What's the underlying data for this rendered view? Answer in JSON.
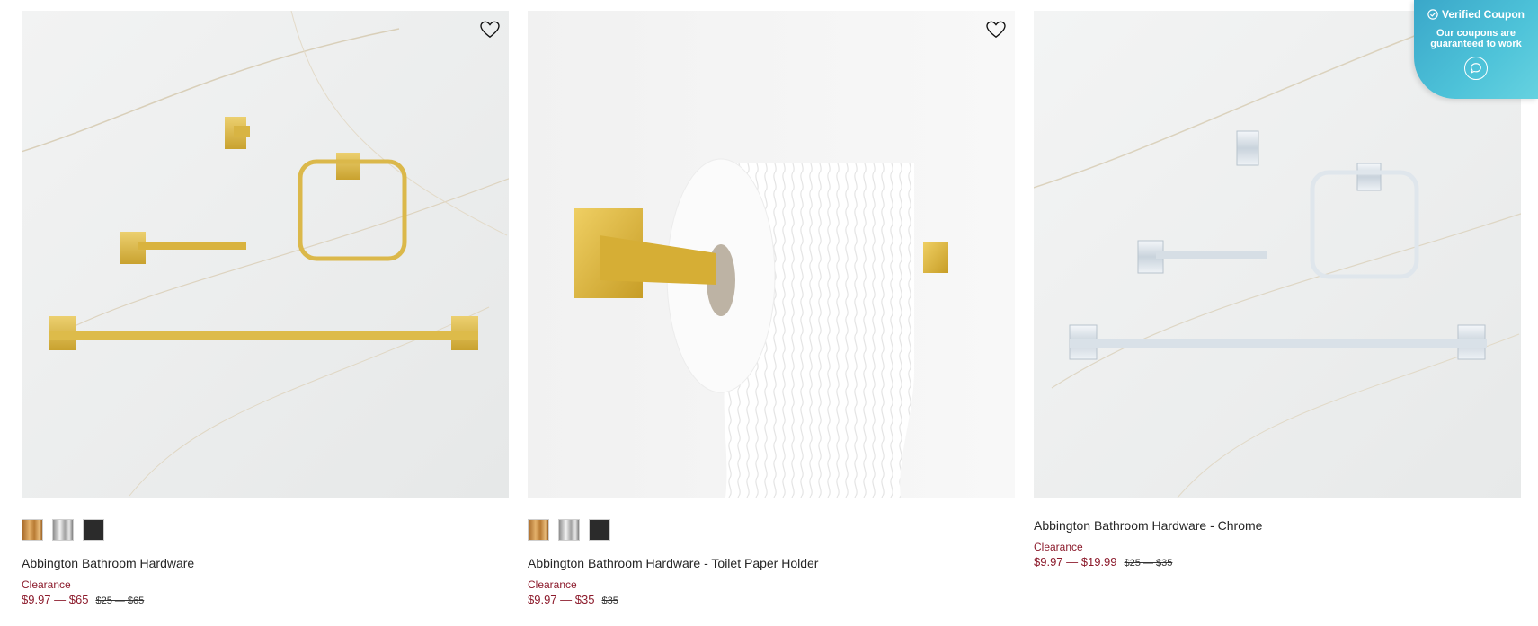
{
  "products": [
    {
      "name": "Abbington Bathroom Hardware",
      "tag": "Clearance",
      "sale_price": "$9.97 — $65",
      "was_price": "$25 — $65",
      "swatches": [
        "brass",
        "chrome",
        "black"
      ]
    },
    {
      "name": "Abbington Bathroom Hardware - Toilet Paper Holder",
      "tag": "Clearance",
      "sale_price": "$9.97 — $35",
      "was_price": "$35",
      "swatches": [
        "brass",
        "chrome",
        "black"
      ]
    },
    {
      "name": "Abbington Bathroom Hardware - Chrome",
      "tag": "Clearance",
      "sale_price": "$9.97 — $19.99",
      "was_price": "$25 — $35",
      "swatches": []
    }
  ],
  "coupon": {
    "title": "Verified Coupon",
    "subtitle": "Our coupons are guaranteed to work"
  },
  "icons": {
    "wishlist": "heart-outline-icon",
    "coupon_check": "check-circle-icon",
    "coupon_chat": "chat-bubble-icon"
  },
  "colors": {
    "sale": "#8c1b2c",
    "coupon_bg": "#4ec3d9",
    "brass": "#d9b13b",
    "chrome": "#dfe7ee"
  }
}
